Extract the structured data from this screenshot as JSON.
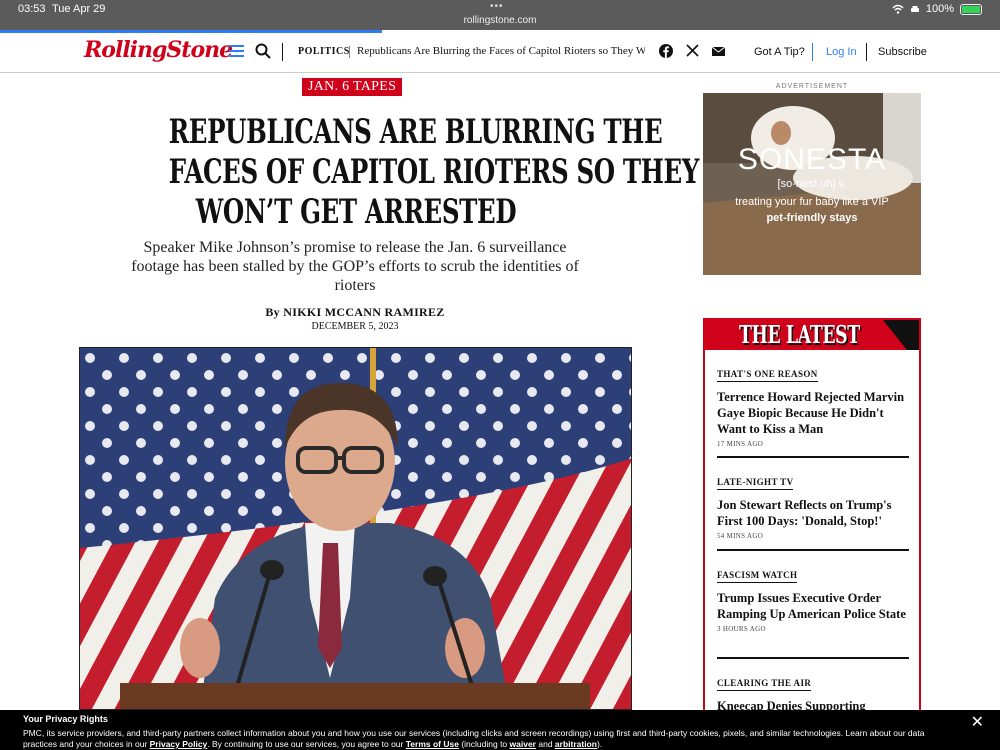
{
  "status_bar": {
    "time": "03:53",
    "date": "Tue Apr 29",
    "url": "rollingstone.com",
    "battery": "100%",
    "battery_level": 1.0
  },
  "header": {
    "logo": "RollingStone",
    "category": "POLITICS",
    "headline": "Republicans Are Blurring the Faces of Capitol Rioters so They Won't Get Arrested",
    "tip": "Got A Tip?",
    "login": "Log In",
    "subscribe": "Subscribe"
  },
  "article": {
    "tag": "JAN. 6 TAPES",
    "headline_lines": [
      "Republicans Are Blurring The",
      "Faces of Capitol Rioters So They",
      "Won’t Get Arrested"
    ],
    "dek": "Speaker Mike Johnson’s promise to release the Jan. 6 surveillance footage has been stalled by the GOP’s efforts to scrub the identities of rioters",
    "byline": "By NIKKI MCCANN RAMIREZ",
    "date": "DECEMBER 5, 2023"
  },
  "ad": {
    "label": "ADVERTISEMENT",
    "brand": "SONESTA",
    "pronunciation": "[so-nest-uh] v.",
    "line1": "treating your fur baby like a VIP",
    "line2": "pet-friendly stays"
  },
  "latest": {
    "title": "THE LATEST",
    "items": [
      {
        "kicker": "THAT'S ONE REASON",
        "title": "Terrence Howard Rejected Marvin Gaye Biopic Because He Didn't Want to Kiss a Man",
        "time": "17 MINS AGO"
      },
      {
        "kicker": "LATE-NIGHT TV",
        "title": "Jon Stewart Reflects on Trump's First 100 Days: 'Donald, Stop!'",
        "time": "54 MINS AGO"
      },
      {
        "kicker": "FASCISM WATCH",
        "title": "Trump Issues Executive Order Ramping Up American Police State",
        "time": "3 HOURS AGO"
      },
      {
        "kicker": "CLEARING THE AIR",
        "title": "Kneecap Denies Supporting",
        "time": ""
      }
    ]
  },
  "privacy": {
    "title": "Your Privacy Rights",
    "text_before": "PMC, its service providers, and third-party partners collect information about you and how you use our services (including clicks and screen recordings) using first and third-party cookies, pixels, and similar technologies. Learn about our data practices and your choices in our ",
    "privacy_link": "Privacy Policy",
    "text_mid": ". By continuing to use our services, you agree to our ",
    "terms_link": "Terms of Use",
    "text_mid2": " (including to ",
    "waiver_link": "waiver",
    "text_and": " and ",
    "arbitration_link": "arbitration",
    "text_end": ").",
    "close": "✕"
  },
  "colors": {
    "brand_red": "#d0021b",
    "link_blue": "#2f7df6"
  }
}
